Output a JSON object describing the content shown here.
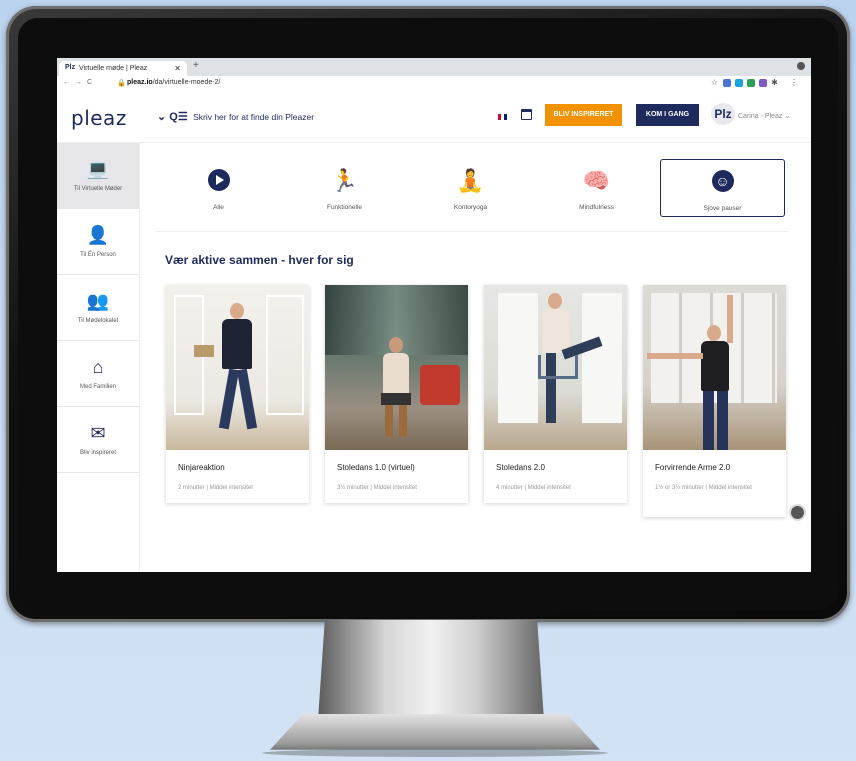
{
  "browser": {
    "tab_title": "Virtuelle møde | Pleaz",
    "tab_favicon": "Plz",
    "url_domain": "pleaz.io",
    "url_path": "/da/virtuelle-moede-2/"
  },
  "header": {
    "logo": "pleaz",
    "search_placeholder": "Skriv her for at finde din Pleazer",
    "btn_inspire": "BLIV INSPIRERET",
    "btn_start": "KOM I GANG",
    "avatar_text": "Plz",
    "user_name": "Carina - Pleaz"
  },
  "sidebar": {
    "items": [
      {
        "label": "Til Virtuelle Møder",
        "icon": "laptop-icon"
      },
      {
        "label": "Til Én Person",
        "icon": "person-icon"
      },
      {
        "label": "Til Mødelokalet",
        "icon": "group-icon"
      },
      {
        "label": "Med Familien",
        "icon": "home-icon"
      },
      {
        "label": "Bliv inspireret",
        "icon": "mail-icon"
      }
    ]
  },
  "categories": [
    {
      "label": "Alle",
      "icon": "play-icon"
    },
    {
      "label": "Funktionelle",
      "icon": "exercise-icon"
    },
    {
      "label": "Kontoryoga",
      "icon": "yoga-icon"
    },
    {
      "label": "Mindfulness",
      "icon": "brain-icon"
    },
    {
      "label": "Sjove pauser",
      "icon": "smile-icon"
    }
  ],
  "section_title": "Vær aktive sammen - hver for sig",
  "cards": [
    {
      "title": "Ninjareaktion",
      "meta": "2 minutter   |   Middel intensitet"
    },
    {
      "title": "Stoledans 1.0 (virtuel)",
      "meta": "3½ minutter   |   Middel intensitet"
    },
    {
      "title": "Stoledans 2.0",
      "meta": "4 minutter   |   Middel intensitet"
    },
    {
      "title": "Forvirrende Arme 2.0",
      "meta": "1½ or 3½ minutter   |   Middel intensitet"
    }
  ],
  "colors": {
    "brand": "#1f2a5c",
    "accent": "#f39200"
  }
}
